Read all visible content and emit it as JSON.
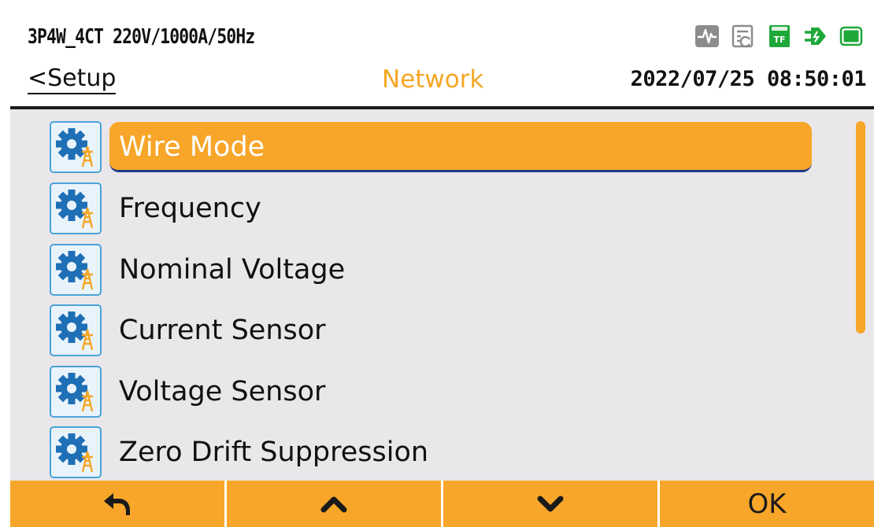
{
  "header": {
    "config": "3P4W_4CT 220V/1000A/50Hz",
    "back_label": "<Setup",
    "title": "Network",
    "datetime": "2022/07/25 08:50:01",
    "status_icons": [
      "waveform-icon",
      "record-icon",
      "tf-card-icon",
      "power-plug-icon",
      "battery-icon"
    ]
  },
  "menu": {
    "selected_index": 0,
    "items": [
      {
        "label": "Wire Mode",
        "icon": "gear-tower-icon"
      },
      {
        "label": "Frequency",
        "icon": "gear-tower-icon"
      },
      {
        "label": "Nominal Voltage",
        "icon": "gear-tower-icon"
      },
      {
        "label": "Current Sensor",
        "icon": "gear-tower-icon"
      },
      {
        "label": "Voltage Sensor",
        "icon": "gear-tower-icon"
      },
      {
        "label": "Zero Drift Suppression",
        "icon": "gear-tower-icon"
      }
    ]
  },
  "softkeys": {
    "back_icon": "return-arrow-icon",
    "up_icon": "chevron-up-icon",
    "down_icon": "chevron-down-icon",
    "ok_label": "OK"
  },
  "colors": {
    "accent": "#F7A629",
    "title_orange": "#F5A623",
    "list_bg": "#EAE7EA",
    "icon_border": "#4AA3D8",
    "icon_gear": "#1E6FB5",
    "status_green": "#1FA83A",
    "status_gray": "#8C8C8C",
    "selection_underline": "#1E3A8A"
  }
}
